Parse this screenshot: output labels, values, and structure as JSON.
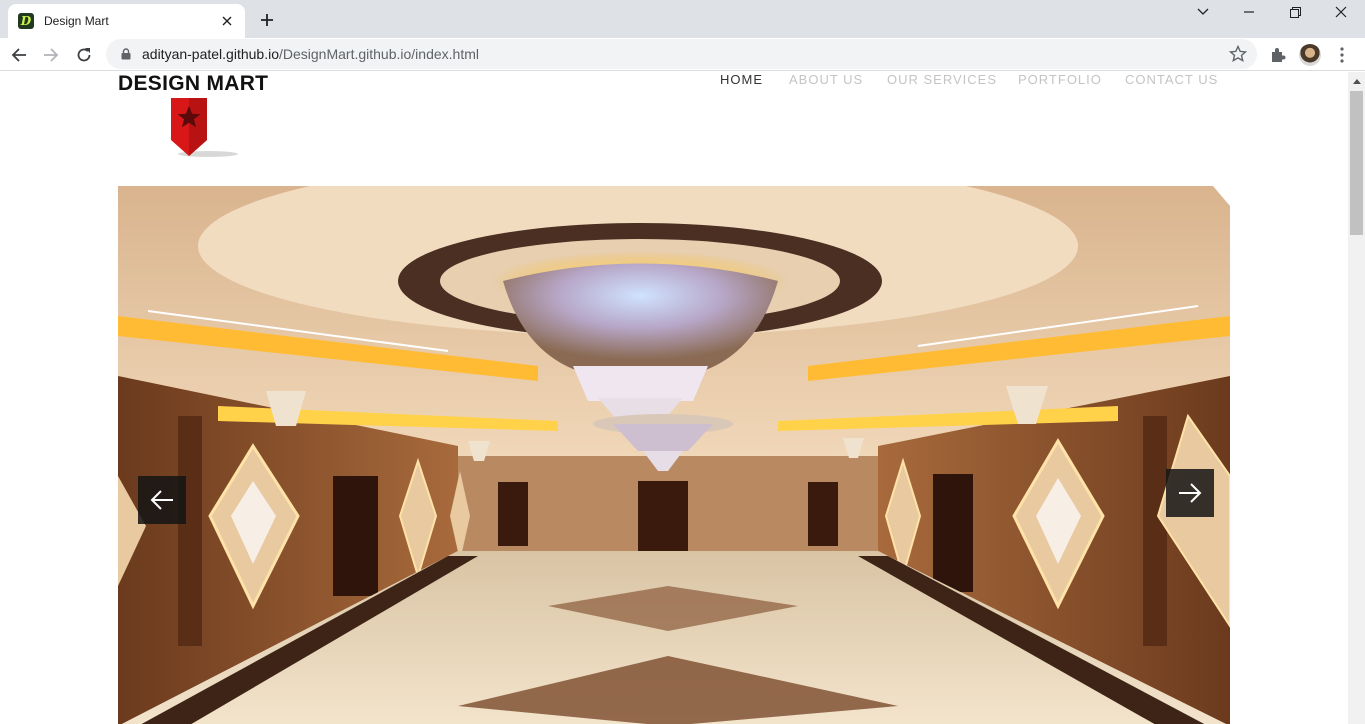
{
  "browser": {
    "tab_title": "Design Mart",
    "favicon_letter": "D",
    "url_host": "adityan-patel.github.io",
    "url_path": "/DesignMart.github.io/index.html",
    "icons": [
      "back-icon",
      "forward-icon",
      "reload-icon",
      "lock-icon",
      "star-icon",
      "puzzle-icon",
      "kebab-menu-icon",
      "close-icon",
      "plus-icon",
      "chevron-down-icon",
      "minimize-icon",
      "restore-icon"
    ]
  },
  "site": {
    "brand": "DESIGN MART",
    "nav": [
      {
        "label": "HOME",
        "active": true
      },
      {
        "label": "ABOUT US",
        "active": false
      },
      {
        "label": "OUR SERVICES",
        "active": false
      },
      {
        "label": "PORTFOLIO",
        "active": false
      },
      {
        "label": "CONTACT US",
        "active": false
      }
    ],
    "colors": {
      "logo_red": "#d81818",
      "nav_active": "#333333",
      "nav_inactive": "#c4c4c4"
    }
  }
}
